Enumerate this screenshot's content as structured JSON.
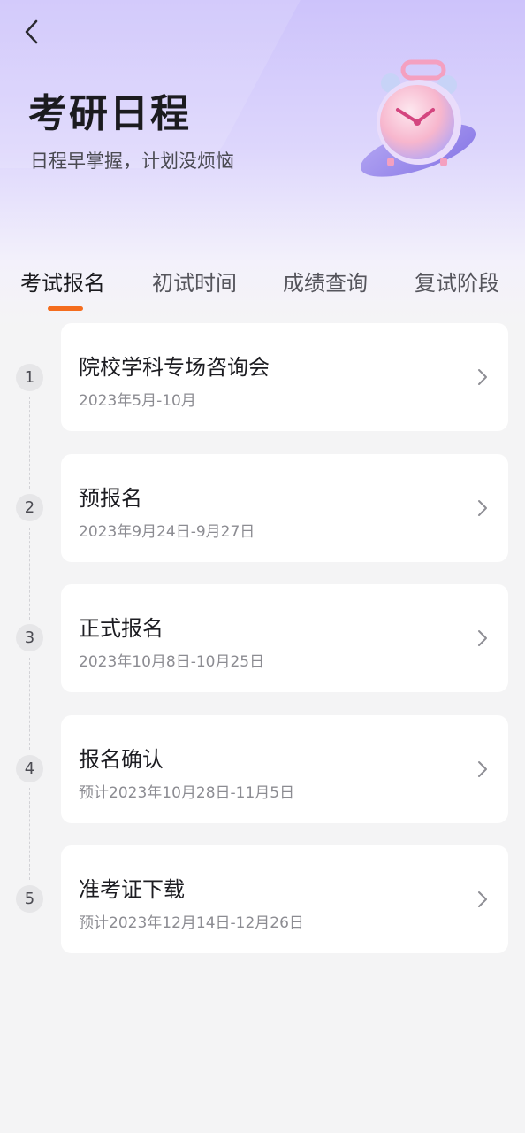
{
  "header": {
    "title": "考研日程",
    "subtitle": "日程早掌握，计划没烦恼"
  },
  "tabs": [
    {
      "label": "考试报名",
      "active": true
    },
    {
      "label": "初试时间",
      "active": false
    },
    {
      "label": "成绩查询",
      "active": false
    },
    {
      "label": "复试阶段",
      "active": false
    }
  ],
  "colors": {
    "accent": "#f46d1e",
    "header_gradient_top": "#cdc3fb",
    "background": "#f4f4f5"
  },
  "steps": [
    {
      "num": "1",
      "title": "院校学科专场咨询会",
      "date": "2023年5月-10月"
    },
    {
      "num": "2",
      "title": "预报名",
      "date": "2023年9月24日-9月27日"
    },
    {
      "num": "3",
      "title": "正式报名",
      "date": "2023年10月8日-10月25日"
    },
    {
      "num": "4",
      "title": "报名确认",
      "date": "预计2023年10月28日-11月5日"
    },
    {
      "num": "5",
      "title": "准考证下载",
      "date": "预计2023年12月14日-12月26日"
    }
  ],
  "icons": {
    "back": "chevron-left-icon",
    "clock": "alarm-clock-icon",
    "row_arrow": "chevron-right-icon"
  }
}
